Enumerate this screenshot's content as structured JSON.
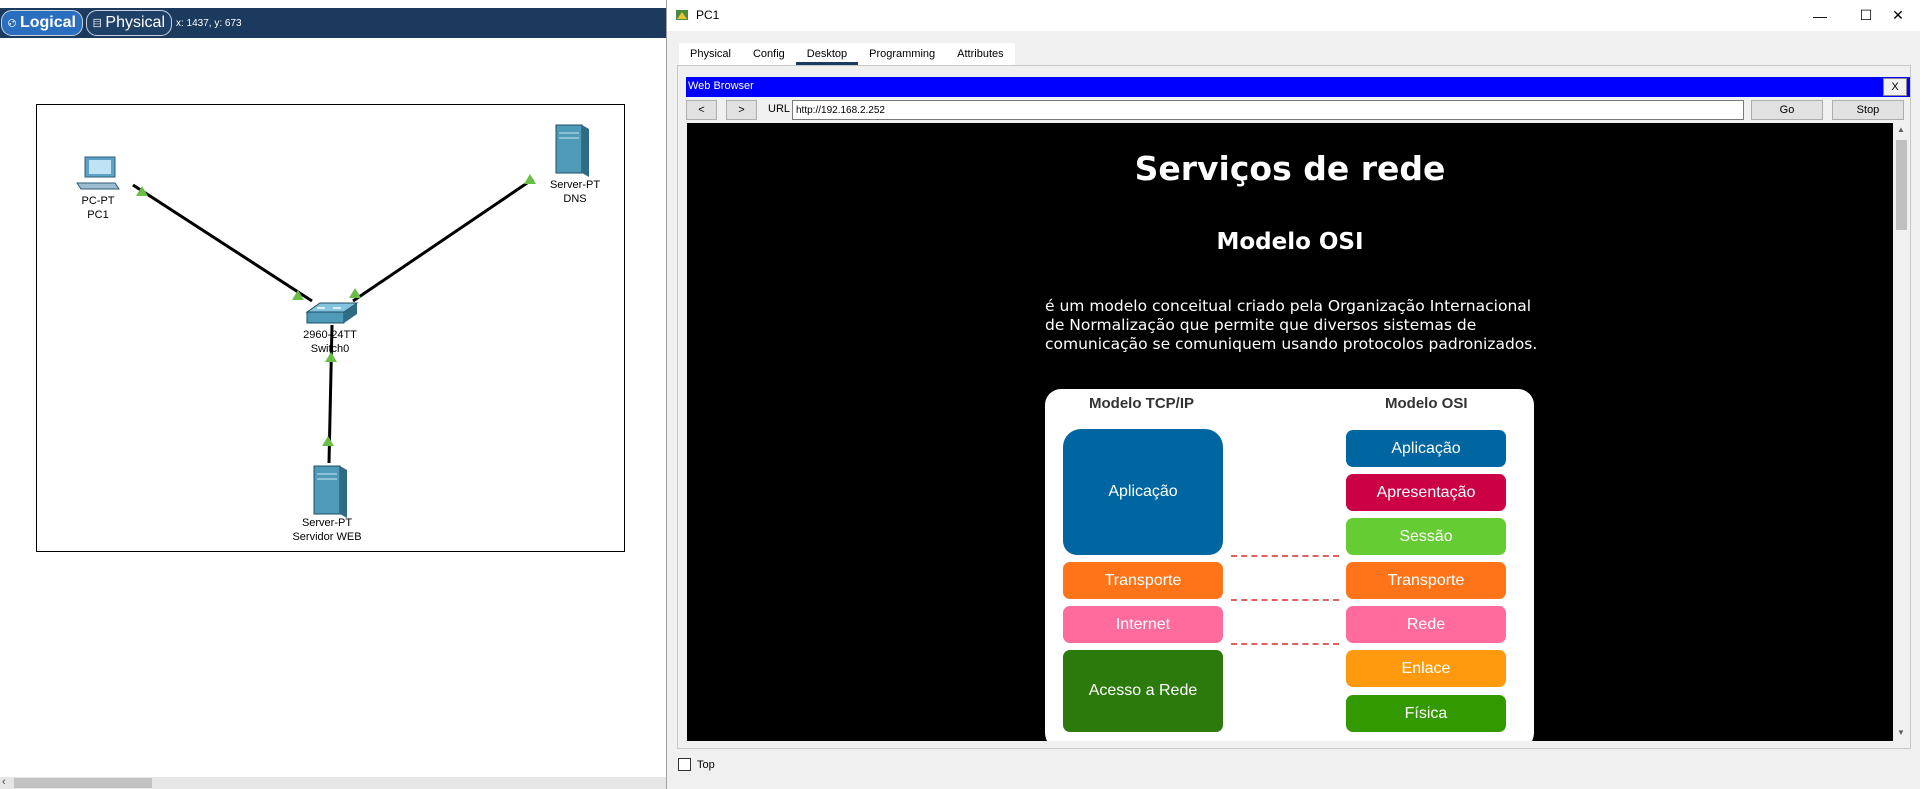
{
  "workspace": {
    "logical_label": "Logical",
    "physical_label": "Physical",
    "coordinates": "x: 1437, y: 673",
    "devices": [
      {
        "id": "pc1",
        "type": "PC-PT",
        "name": "PC1"
      },
      {
        "id": "dns",
        "type": "Server-PT",
        "name": "DNS"
      },
      {
        "id": "switch",
        "type": "2960-24TT",
        "name": "Switch0"
      },
      {
        "id": "web",
        "type": "Server-PT",
        "name": "Servidor WEB"
      }
    ],
    "link_color": "#000000",
    "link_light_color": "#6abe45"
  },
  "window": {
    "title": "PC1",
    "controls": {
      "minimize": "—",
      "maximize": "☐",
      "close": "✕"
    },
    "tabs": [
      "Physical",
      "Config",
      "Desktop",
      "Programming",
      "Attributes"
    ],
    "active_tab": "Desktop",
    "top_checkbox_label": "Top"
  },
  "browser": {
    "title": "Web Browser",
    "close_label": "X",
    "back_label": "<",
    "forward_label": ">",
    "url_label": "URL",
    "url_value": "http://192.168.2.252",
    "go_label": "Go",
    "stop_label": "Stop",
    "title_bar_color": "#0000ff"
  },
  "page": {
    "heading": "Serviços de rede",
    "subheading": "Modelo OSI",
    "paragraph": "é um modelo conceitual criado pela Organização Internacional de Normalização que permite que diversos sistemas de comunicação se comuniquem usando protocolos padronizados.",
    "figure": {
      "tcp_title": "Modelo TCP/IP",
      "osi_title": "Modelo OSI",
      "tcp_layers": [
        {
          "label": "Aplicação",
          "color": "#0066a1"
        },
        {
          "label": "Transporte",
          "color": "#ff7418"
        },
        {
          "label": "Internet",
          "color": "#ff6b9d"
        },
        {
          "label": "Acesso a Rede",
          "color": "#2b7a0b"
        }
      ],
      "osi_layers": [
        {
          "label": "Aplicação",
          "color": "#0066a1"
        },
        {
          "label": "Apresentação",
          "color": "#cc0044"
        },
        {
          "label": "Sessão",
          "color": "#66cc33"
        },
        {
          "label": "Transporte",
          "color": "#ff7418"
        },
        {
          "label": "Rede",
          "color": "#ff6b9d"
        },
        {
          "label": "Enlace",
          "color": "#ff9a0e"
        },
        {
          "label": "Física",
          "color": "#339900"
        }
      ]
    }
  }
}
